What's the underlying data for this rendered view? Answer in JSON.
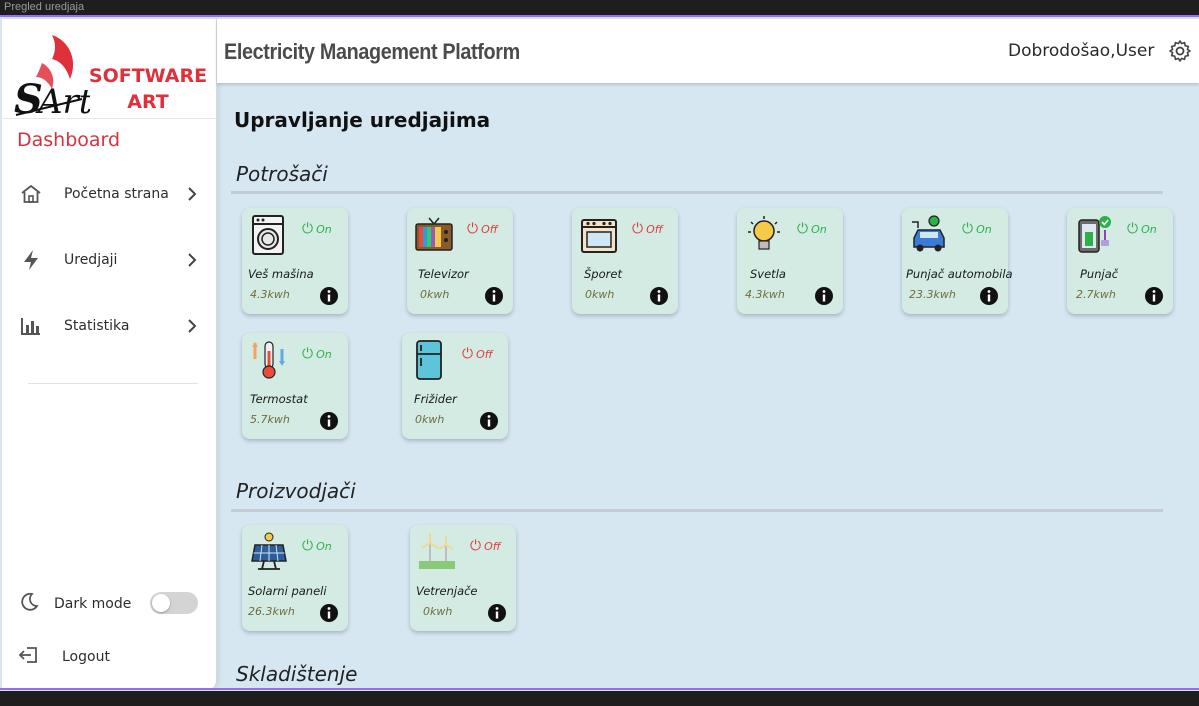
{
  "frame_label": "Pregled uredjaja",
  "brand": {
    "line1": "SOFTWARE",
    "line2": "ART"
  },
  "sidebar": {
    "title": "Dashboard",
    "items": [
      {
        "label": "Početna strana",
        "icon": "home-icon"
      },
      {
        "label": "Uredjaji",
        "icon": "bolt-icon"
      },
      {
        "label": "Statistika",
        "icon": "bar-chart-icon"
      }
    ],
    "dark_mode": {
      "label": "Dark mode",
      "enabled": false
    },
    "logout": "Logout"
  },
  "header": {
    "title": "Electricity Management Platform",
    "welcome": "Dobrodošao,User"
  },
  "main": {
    "title": "Upravljanje uredjajima",
    "sections": [
      {
        "title": "Potrošači",
        "devices": [
          {
            "name": "Veš mašina",
            "status": "On",
            "kwh": "4.3kwh",
            "icon": "washing-machine-icon"
          },
          {
            "name": "Televizor",
            "status": "Off",
            "kwh": "0kwh",
            "icon": "tv-icon"
          },
          {
            "name": "Šporet",
            "status": "Off",
            "kwh": "0kwh",
            "icon": "oven-icon"
          },
          {
            "name": "Svetla",
            "status": "On",
            "kwh": "4.3kwh",
            "icon": "light-bulb-icon"
          },
          {
            "name": "Punjač automobila",
            "status": "On",
            "kwh": "23.3kwh",
            "icon": "car-charger-icon"
          },
          {
            "name": "Punjač",
            "status": "On",
            "kwh": "2.7kwh",
            "icon": "phone-charger-icon"
          },
          {
            "name": "Termostat",
            "status": "On",
            "kwh": "5.7kwh",
            "icon": "thermostat-icon"
          },
          {
            "name": "Frižider",
            "status": "Off",
            "kwh": "0kwh",
            "icon": "fridge-icon"
          }
        ]
      },
      {
        "title": "Proizvodjači",
        "devices": [
          {
            "name": "Solarni paneli",
            "status": "On",
            "kwh": "26.3kwh",
            "icon": "solar-panel-icon"
          },
          {
            "name": "Vetrenjače",
            "status": "Off",
            "kwh": "0kwh",
            "icon": "wind-turbine-icon"
          }
        ]
      },
      {
        "title": "Skladištenje",
        "devices": []
      }
    ]
  },
  "colors": {
    "on": "#2bb14a",
    "off": "#e03a3a",
    "card_bg": "#d3ebe3",
    "main_bg": "#d6e7f2",
    "brand": "#e0313b"
  }
}
